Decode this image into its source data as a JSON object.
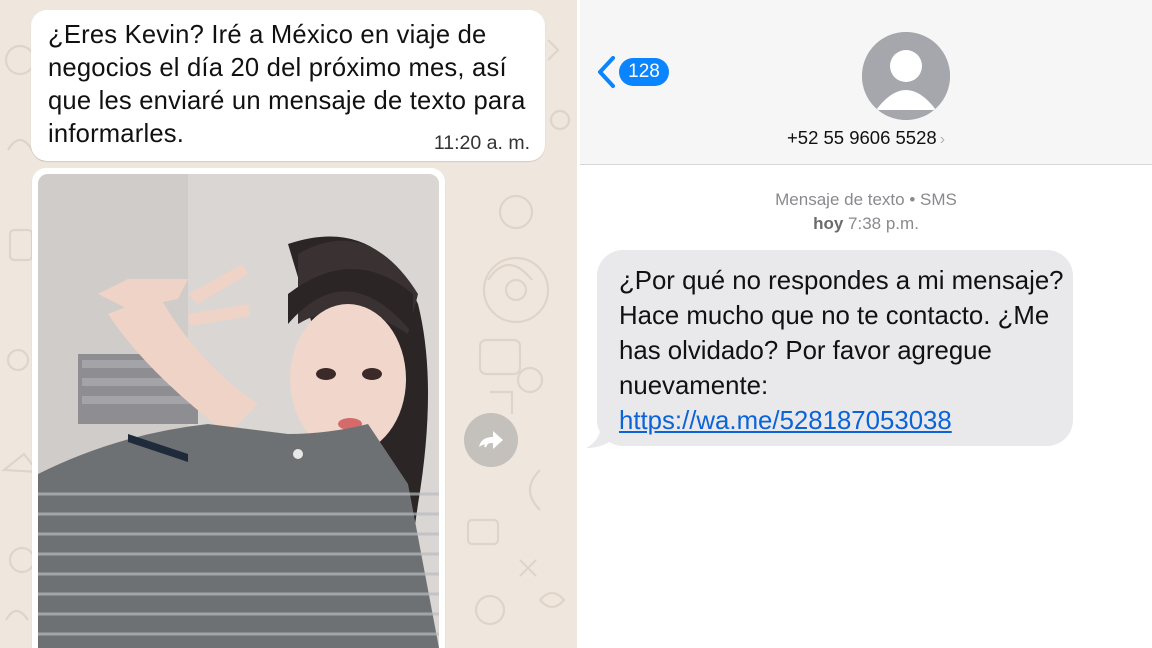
{
  "whatsapp": {
    "message_text": "¿Eres Kevin? Iré a México en viaje de negocios el día 20 del próximo mes, así que les enviaré un mensaje de texto para informarles.",
    "message_time": "11:20 a. m.",
    "photo_icon": "photo-of-woman",
    "forward_icon": "forward-icon"
  },
  "sms": {
    "back_badge": "128",
    "contact_number": "+52 55 9606 5528",
    "channel_label": "Mensaje de texto • SMS",
    "date_label": "hoy",
    "time_label": "7:38 p.m.",
    "message_text": "¿Por qué no respondes a mi mensaje? Hace mucho que no te contacto. ¿Me has olvidado? Por favor agregue nuevamente:",
    "message_link": "https://wa.me/528187053038"
  },
  "colors": {
    "wa_background": "#efe7de",
    "ios_blue": "#0a84ff",
    "sms_bubble": "#e9e9eb",
    "link": "#0b63d9"
  }
}
